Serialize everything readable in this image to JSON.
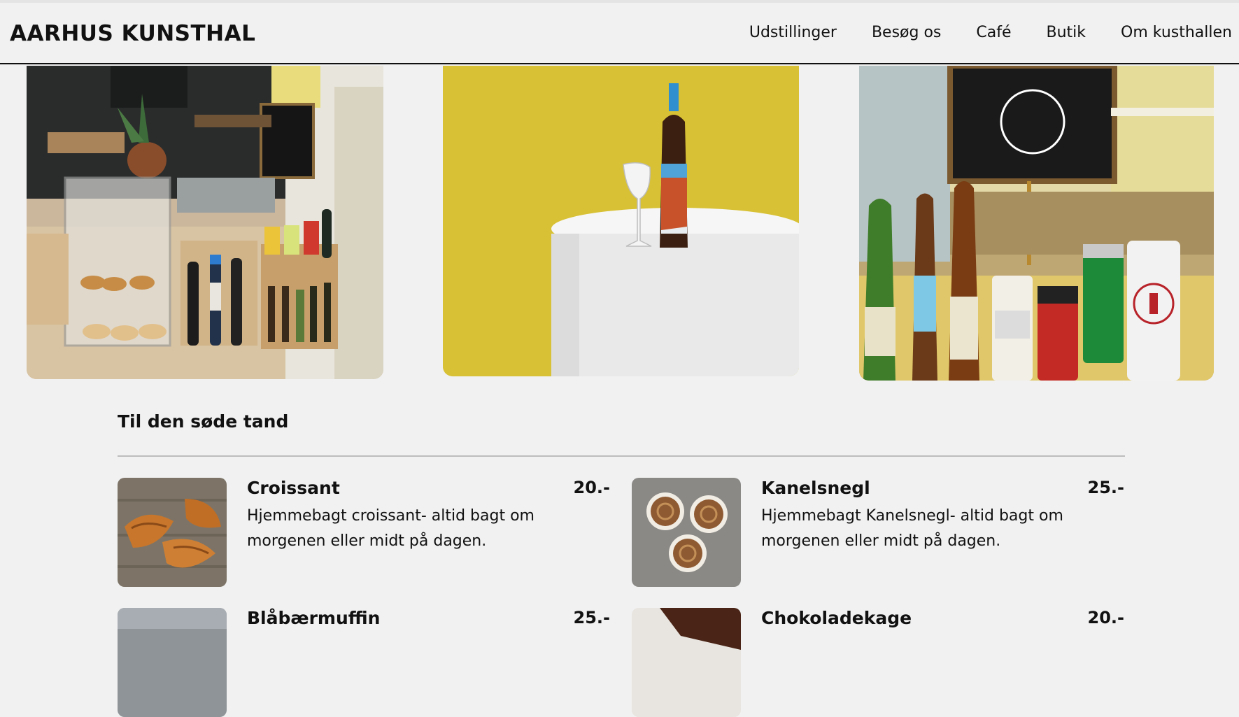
{
  "brand": "AARHUS KUNSTHAL",
  "nav": [
    "Udstillinger",
    "Besøg os",
    "Café",
    "Butik",
    "Om kusthallen"
  ],
  "gallery": [
    {
      "alt": "café counter with pastries and bottles"
    },
    {
      "alt": "wine bottle and glass on white pedestal"
    },
    {
      "alt": "craft beer bottles and cans in front of chalkboard"
    }
  ],
  "section": {
    "title": "Til den søde tand",
    "items": [
      {
        "name": "Croissant",
        "price": "20.-",
        "desc": "Hjemmebagt croissant- altid bagt om morgenen eller midt på dagen."
      },
      {
        "name": "Kanelsnegl",
        "price": "25.-",
        "desc": "Hjemmebagt Kanelsnegl- altid bagt om morgenen eller midt på dagen."
      },
      {
        "name": "Blåbærmuffin",
        "price": "25.-",
        "desc": ""
      },
      {
        "name": "Chokoladekage",
        "price": "20.-",
        "desc": ""
      }
    ]
  },
  "colors": {
    "background": "#f1f1f1",
    "text": "#111111",
    "accent_yellow": "#d8c030"
  }
}
